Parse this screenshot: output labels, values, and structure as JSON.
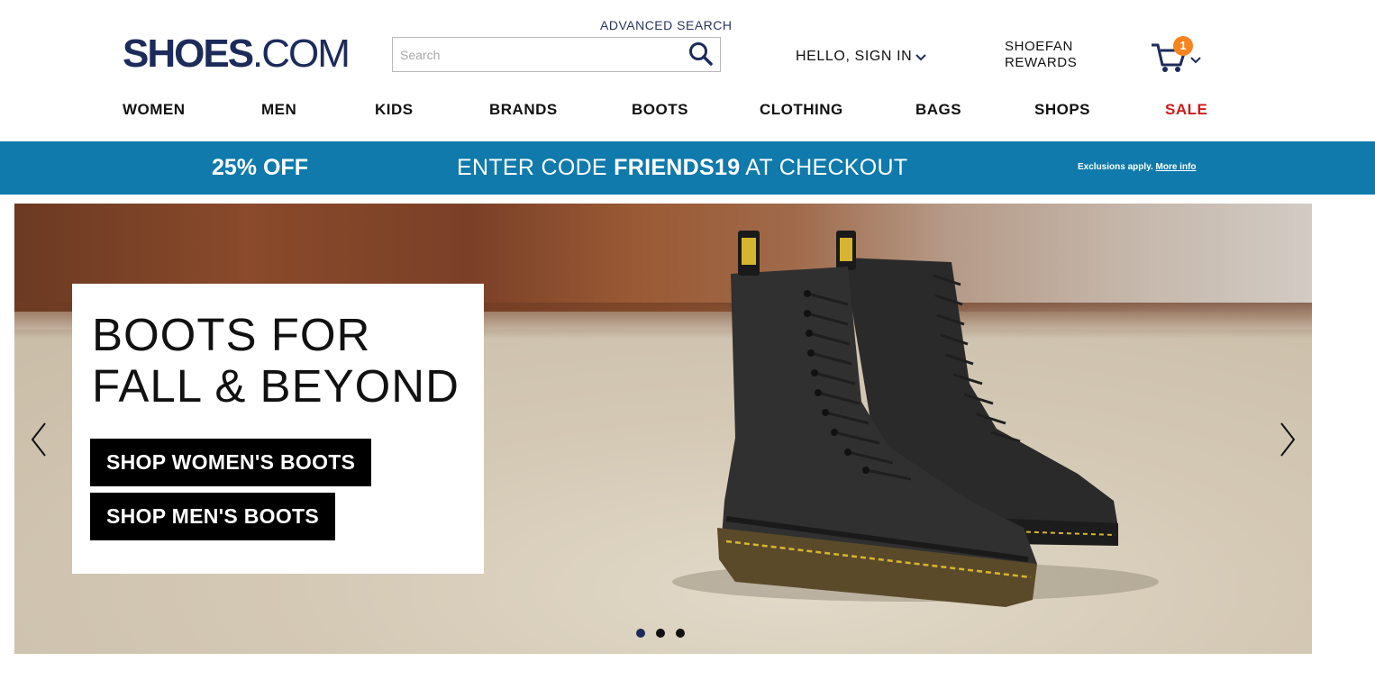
{
  "header": {
    "logo_bold": "SHOES",
    "logo_light": ".COM",
    "advanced_search": "ADVANCED SEARCH",
    "search_placeholder": "Search",
    "signin": "HELLO, SIGN IN",
    "rewards_line1": "SHOEFAN",
    "rewards_line2": "REWARDS",
    "cart_count": "1"
  },
  "nav": {
    "items": [
      {
        "label": "WOMEN"
      },
      {
        "label": "MEN"
      },
      {
        "label": "KIDS"
      },
      {
        "label": "BRANDS"
      },
      {
        "label": "BOOTS"
      },
      {
        "label": "CLOTHING"
      },
      {
        "label": "BAGS"
      },
      {
        "label": "SHOPS"
      },
      {
        "label": "SALE"
      }
    ]
  },
  "promo": {
    "discount": "25% OFF",
    "code_prefix": "ENTER CODE ",
    "code": "FRIENDS19",
    "code_suffix": " AT CHECKOUT",
    "exclusions": "Exclusions apply.",
    "more_info": "More info",
    "bg_color": "#0f7aab"
  },
  "hero": {
    "title": "BOOTS FOR\nFALL & BEYOND",
    "button_women": "SHOP WOMEN'S BOOTS",
    "button_men": "SHOP MEN'S BOOTS",
    "slide_count": 3,
    "active_slide": 1
  },
  "colors": {
    "brand_navy": "#1d2b5a",
    "sale_red": "#cc1b1b",
    "cart_badge": "#f7841f"
  }
}
